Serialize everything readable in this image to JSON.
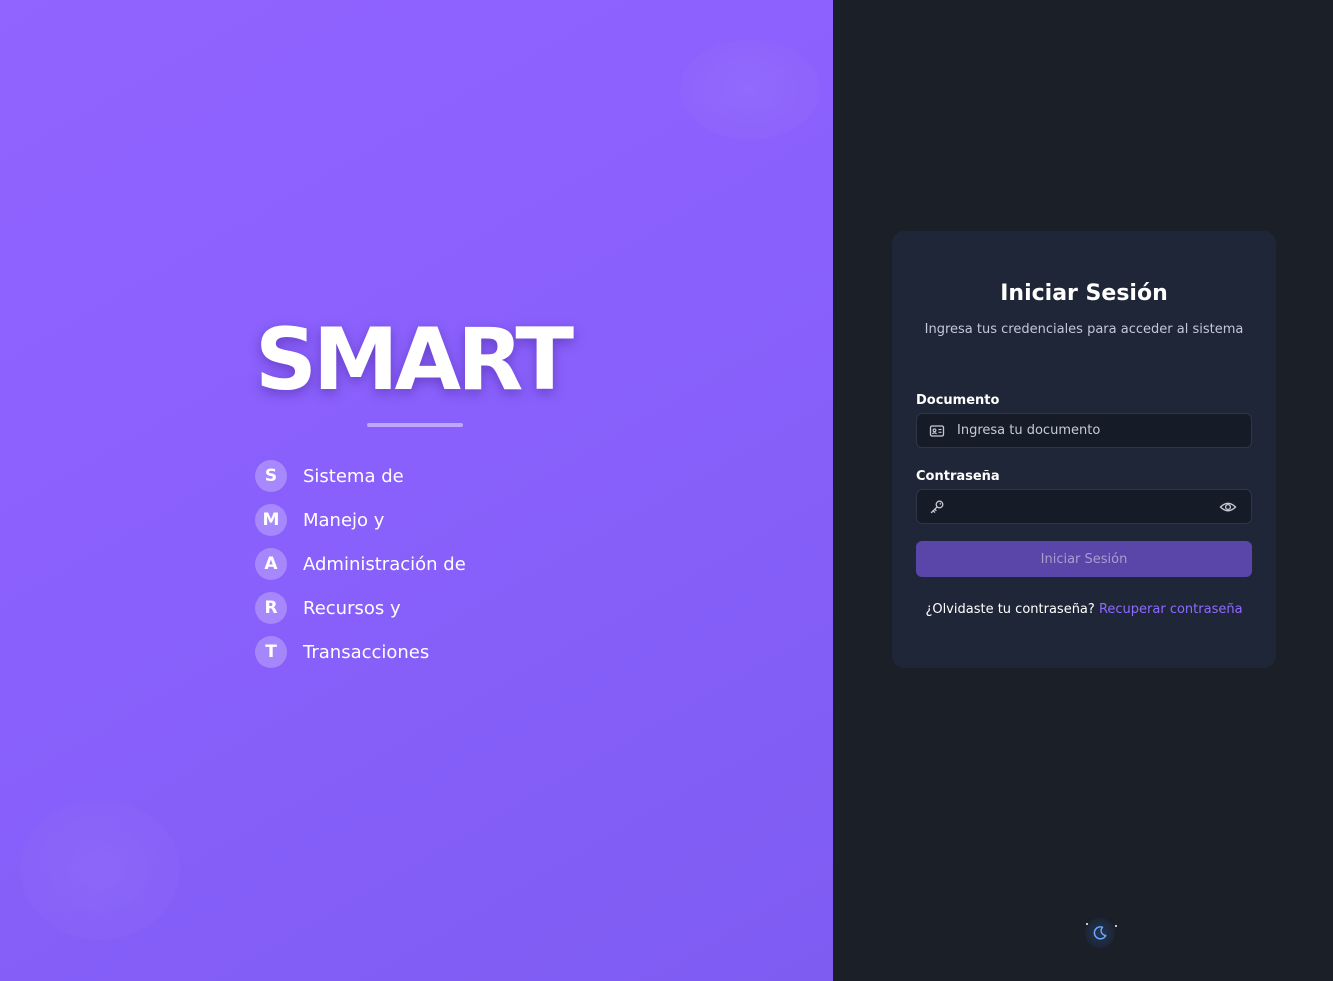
{
  "brand": {
    "title": "SMART",
    "acronym": [
      {
        "letter": "S",
        "word": "Sistema de"
      },
      {
        "letter": "M",
        "word": "Manejo y"
      },
      {
        "letter": "A",
        "word": "Administración de"
      },
      {
        "letter": "R",
        "word": "Recursos y"
      },
      {
        "letter": "T",
        "word": "Transacciones"
      }
    ]
  },
  "login": {
    "title": "Iniciar Sesión",
    "subtitle": "Ingresa tus credenciales para acceder al sistema",
    "document": {
      "label": "Documento",
      "placeholder": "Ingresa tu documento",
      "value": "",
      "icon": "id-card-icon"
    },
    "password": {
      "label": "Contraseña",
      "placeholder": "",
      "value": "",
      "icon": "key-icon",
      "toggle_icon": "eye-icon"
    },
    "submit_label": "Iniciar Sesión",
    "forgot_question": "¿Olvidaste tu contraseña?",
    "forgot_link": "Recuperar contraseña"
  },
  "theme_toggle": {
    "icon": "moon-icon"
  },
  "colors": {
    "left_panel": "#8a60fc",
    "right_panel": "#1a1f28",
    "card": "#1f2637",
    "accent": "#8e6bff",
    "button": "#5a45a8"
  }
}
